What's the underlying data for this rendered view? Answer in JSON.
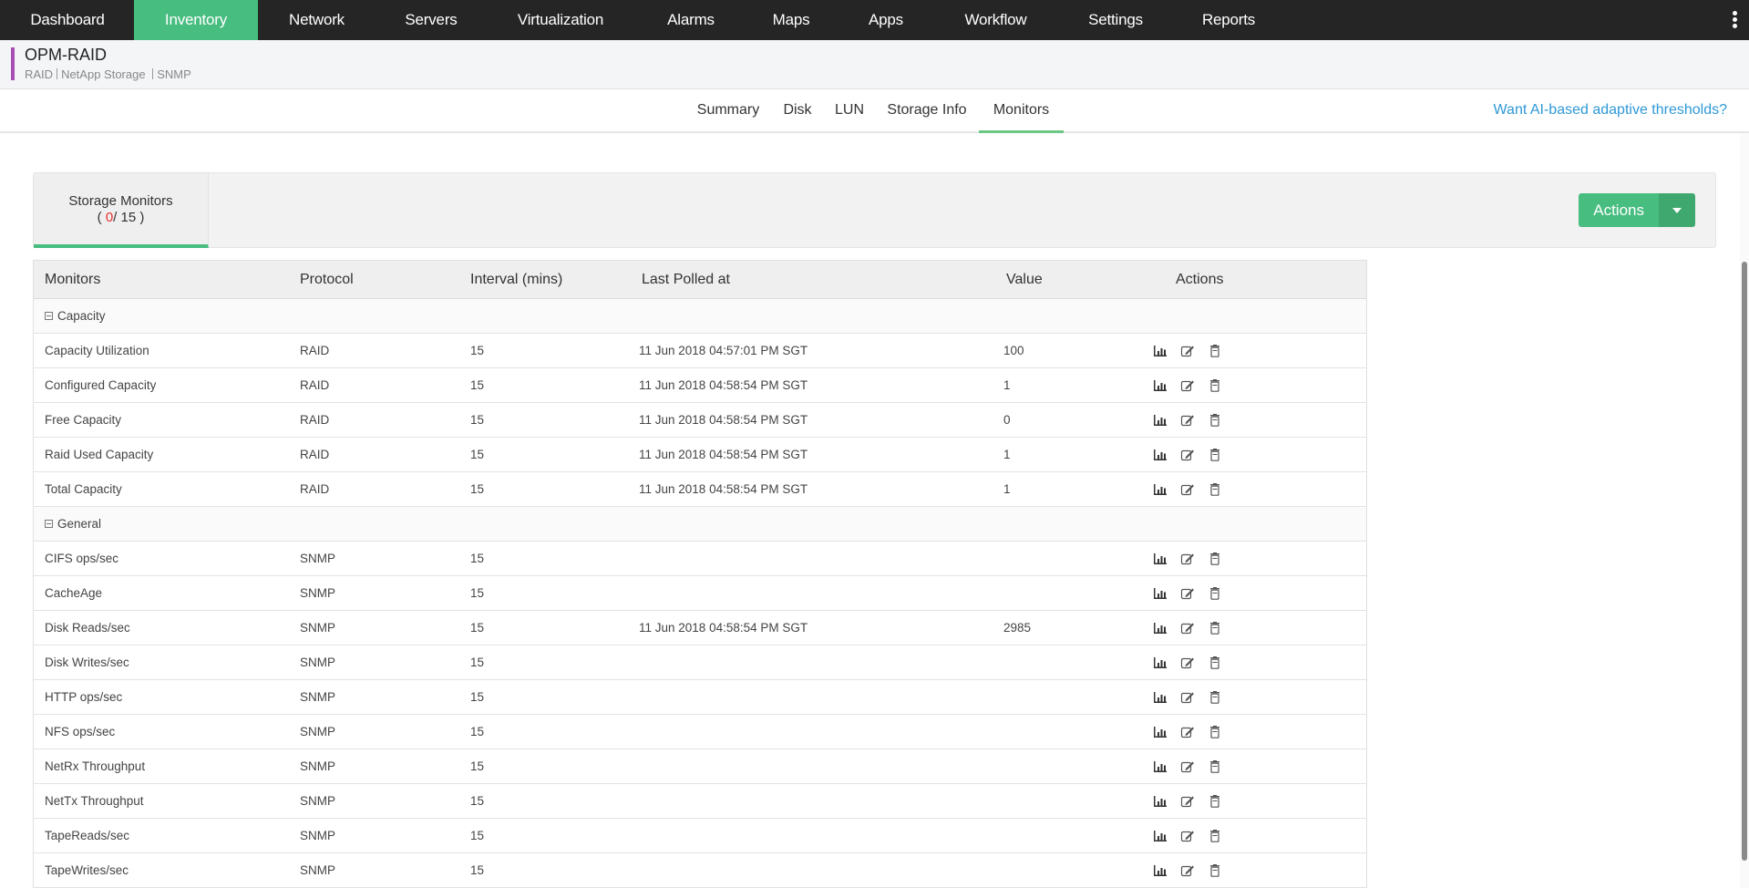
{
  "nav": {
    "items": [
      {
        "label": "Dashboard",
        "active": false
      },
      {
        "label": "Inventory",
        "active": true
      },
      {
        "label": "Network",
        "active": false
      },
      {
        "label": "Servers",
        "active": false
      },
      {
        "label": "Virtualization",
        "active": false
      },
      {
        "label": "Alarms",
        "active": false
      },
      {
        "label": "Maps",
        "active": false
      },
      {
        "label": "Apps",
        "active": false
      },
      {
        "label": "Workflow",
        "active": false
      },
      {
        "label": "Settings",
        "active": false
      },
      {
        "label": "Reports",
        "active": false
      }
    ],
    "more_icon": "kebab-vertical-icon",
    "active_color": "#48bd80"
  },
  "header": {
    "title": "OPM-RAID",
    "tags": [
      "RAID",
      "NetApp Storage",
      "SNMP"
    ],
    "accent_color": "#a64fb4"
  },
  "tabs": {
    "items": [
      {
        "label": "Summary",
        "active": false
      },
      {
        "label": "Disk",
        "active": false
      },
      {
        "label": "LUN",
        "active": false
      },
      {
        "label": "Storage Info",
        "active": false
      },
      {
        "label": "Monitors",
        "active": true
      }
    ],
    "ai_link": "Want AI-based adaptive thresholds?"
  },
  "panel": {
    "tab_label": "Storage Monitors",
    "count_open": "( ",
    "count_alert": "0",
    "count_sep": "/ ",
    "count_total": "15",
    "count_close": " )",
    "actions_label": "Actions",
    "alert_color": "#e8302f"
  },
  "table": {
    "columns": [
      "Monitors",
      "Protocol",
      "Interval (mins)",
      "Last Polled at",
      "Value",
      "Actions"
    ],
    "row_icons": [
      "bar-chart-icon",
      "edit-icon",
      "trash-icon"
    ],
    "groups": [
      {
        "name": "Capacity",
        "rows": [
          {
            "monitor": "Capacity Utilization",
            "protocol": "RAID",
            "interval": "15",
            "last_polled": "11 Jun 2018 04:57:01 PM SGT",
            "value": "100"
          },
          {
            "monitor": "Configured Capacity",
            "protocol": "RAID",
            "interval": "15",
            "last_polled": "11 Jun 2018 04:58:54 PM SGT",
            "value": "1"
          },
          {
            "monitor": "Free Capacity",
            "protocol": "RAID",
            "interval": "15",
            "last_polled": "11 Jun 2018 04:58:54 PM SGT",
            "value": "0"
          },
          {
            "monitor": "Raid Used Capacity",
            "protocol": "RAID",
            "interval": "15",
            "last_polled": "11 Jun 2018 04:58:54 PM SGT",
            "value": "1"
          },
          {
            "monitor": "Total Capacity",
            "protocol": "RAID",
            "interval": "15",
            "last_polled": "11 Jun 2018 04:58:54 PM SGT",
            "value": "1"
          }
        ]
      },
      {
        "name": "General",
        "rows": [
          {
            "monitor": "CIFS ops/sec",
            "protocol": "SNMP",
            "interval": "15",
            "last_polled": "",
            "value": ""
          },
          {
            "monitor": "CacheAge",
            "protocol": "SNMP",
            "interval": "15",
            "last_polled": "",
            "value": ""
          },
          {
            "monitor": "Disk Reads/sec",
            "protocol": "SNMP",
            "interval": "15",
            "last_polled": "11 Jun 2018 04:58:54 PM SGT",
            "value": "2985"
          },
          {
            "monitor": "Disk Writes/sec",
            "protocol": "SNMP",
            "interval": "15",
            "last_polled": "",
            "value": ""
          },
          {
            "monitor": "HTTP ops/sec",
            "protocol": "SNMP",
            "interval": "15",
            "last_polled": "",
            "value": ""
          },
          {
            "monitor": "NFS ops/sec",
            "protocol": "SNMP",
            "interval": "15",
            "last_polled": "",
            "value": ""
          },
          {
            "monitor": "NetRx Throughput",
            "protocol": "SNMP",
            "interval": "15",
            "last_polled": "",
            "value": ""
          },
          {
            "monitor": "NetTx Throughput",
            "protocol": "SNMP",
            "interval": "15",
            "last_polled": "",
            "value": ""
          },
          {
            "monitor": "TapeReads/sec",
            "protocol": "SNMP",
            "interval": "15",
            "last_polled": "",
            "value": ""
          },
          {
            "monitor": "TapeWrites/sec",
            "protocol": "SNMP",
            "interval": "15",
            "last_polled": "",
            "value": ""
          }
        ]
      }
    ]
  }
}
